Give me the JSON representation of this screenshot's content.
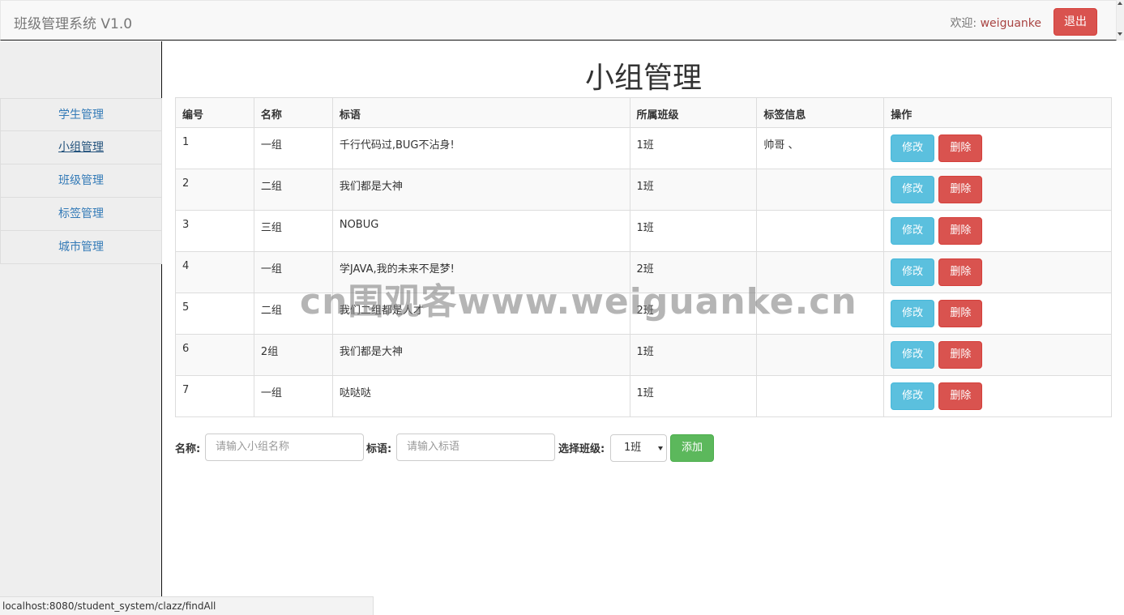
{
  "header": {
    "brand": "班级管理系统 V1.0",
    "welcome_prefix": "欢迎: ",
    "username": "weiguanke",
    "logout_label": "退出"
  },
  "sidebar": {
    "items": [
      {
        "label": "学生管理"
      },
      {
        "label": "小组管理",
        "active": true
      },
      {
        "label": "班级管理"
      },
      {
        "label": "标签管理"
      },
      {
        "label": "城市管理"
      }
    ]
  },
  "main": {
    "title": "小组管理",
    "table": {
      "headers": [
        "编号",
        "名称",
        "标语",
        "所属班级",
        "标签信息",
        "操作"
      ],
      "rows": [
        {
          "id": "1",
          "name": "一组",
          "slogan": "千行代码过,BUG不沾身!",
          "clazz": "1班",
          "tags": "帅哥 、"
        },
        {
          "id": "2",
          "name": "二组",
          "slogan": "我们都是大神",
          "clazz": "1班",
          "tags": ""
        },
        {
          "id": "3",
          "name": "三组",
          "slogan": "NOBUG",
          "clazz": "1班",
          "tags": ""
        },
        {
          "id": "4",
          "name": "一组",
          "slogan": "学JAVA,我的未来不是梦!",
          "clazz": "2班",
          "tags": ""
        },
        {
          "id": "5",
          "name": "二组",
          "slogan": "我们二组都是人才",
          "clazz": "2班",
          "tags": ""
        },
        {
          "id": "6",
          "name": "2组",
          "slogan": "我们都是大神",
          "clazz": "1班",
          "tags": ""
        },
        {
          "id": "7",
          "name": "一组",
          "slogan": "哒哒哒",
          "clazz": "1班",
          "tags": ""
        }
      ],
      "edit_label": "修改",
      "delete_label": "删除"
    },
    "form": {
      "name_label": "名称:",
      "name_placeholder": "请输入小组名称",
      "slogan_label": "标语:",
      "slogan_placeholder": "请输入标语",
      "clazz_label": "选择班级:",
      "clazz_selected": "1班",
      "add_label": "添加"
    }
  },
  "watermark": "cn围观客www.weiguanke.cn",
  "status_url": "localhost:8080/student_system/clazz/findAll",
  "colors": {
    "danger": "#d9534f",
    "info": "#5bc0de",
    "success": "#5cb85c",
    "link": "#337ab7"
  }
}
